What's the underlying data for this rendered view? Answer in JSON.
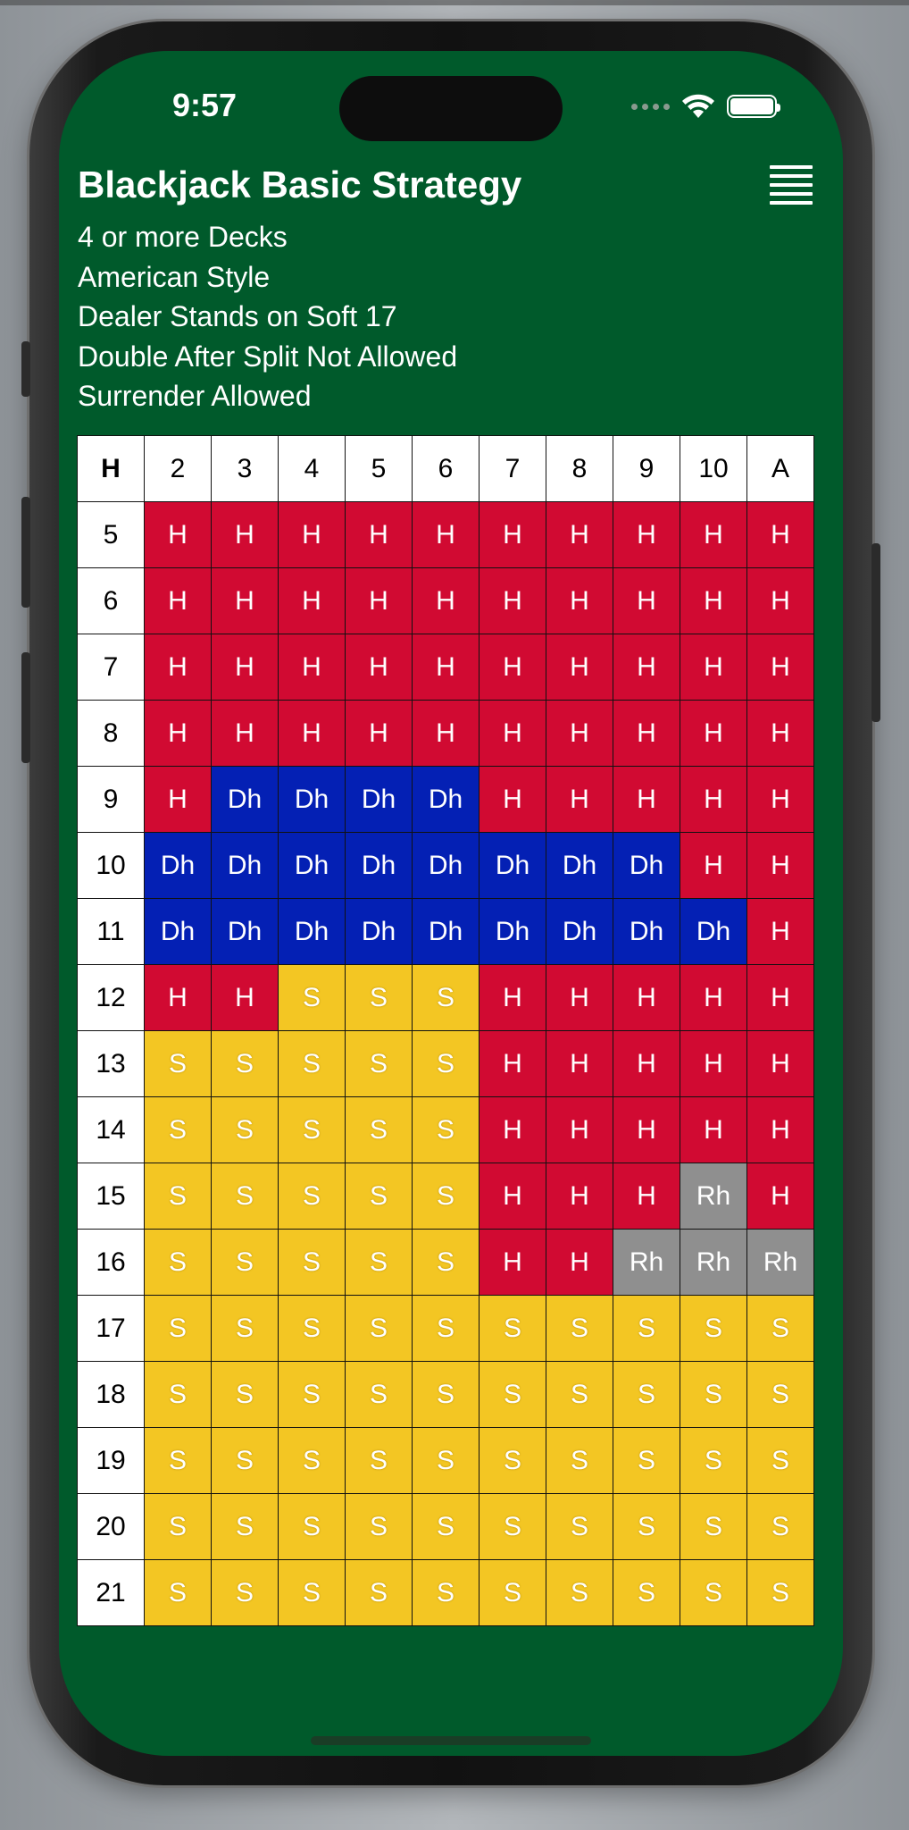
{
  "status_bar": {
    "time": "9:57"
  },
  "header": {
    "title": "Blackjack Basic Strategy",
    "rules": [
      "4 or more Decks",
      "American Style",
      "Dealer Stands on Soft 17",
      "Double After Split Not Allowed",
      "Surrender Allowed"
    ],
    "menu_icon": "hamburger-menu-icon"
  },
  "colors": {
    "background": "#005a2b",
    "H": "#d10a32",
    "Dh": "#0420b4",
    "S": "#f3c623",
    "Rh": "#8f8f8f"
  },
  "table": {
    "corner_label": "H",
    "dealer_cards": [
      "2",
      "3",
      "4",
      "5",
      "6",
      "7",
      "8",
      "9",
      "10",
      "A"
    ],
    "rows": [
      {
        "hand": "5",
        "actions": [
          "H",
          "H",
          "H",
          "H",
          "H",
          "H",
          "H",
          "H",
          "H",
          "H"
        ]
      },
      {
        "hand": "6",
        "actions": [
          "H",
          "H",
          "H",
          "H",
          "H",
          "H",
          "H",
          "H",
          "H",
          "H"
        ]
      },
      {
        "hand": "7",
        "actions": [
          "H",
          "H",
          "H",
          "H",
          "H",
          "H",
          "H",
          "H",
          "H",
          "H"
        ]
      },
      {
        "hand": "8",
        "actions": [
          "H",
          "H",
          "H",
          "H",
          "H",
          "H",
          "H",
          "H",
          "H",
          "H"
        ]
      },
      {
        "hand": "9",
        "actions": [
          "H",
          "Dh",
          "Dh",
          "Dh",
          "Dh",
          "H",
          "H",
          "H",
          "H",
          "H"
        ]
      },
      {
        "hand": "10",
        "actions": [
          "Dh",
          "Dh",
          "Dh",
          "Dh",
          "Dh",
          "Dh",
          "Dh",
          "Dh",
          "H",
          "H"
        ]
      },
      {
        "hand": "11",
        "actions": [
          "Dh",
          "Dh",
          "Dh",
          "Dh",
          "Dh",
          "Dh",
          "Dh",
          "Dh",
          "Dh",
          "H"
        ]
      },
      {
        "hand": "12",
        "actions": [
          "H",
          "H",
          "S",
          "S",
          "S",
          "H",
          "H",
          "H",
          "H",
          "H"
        ]
      },
      {
        "hand": "13",
        "actions": [
          "S",
          "S",
          "S",
          "S",
          "S",
          "H",
          "H",
          "H",
          "H",
          "H"
        ]
      },
      {
        "hand": "14",
        "actions": [
          "S",
          "S",
          "S",
          "S",
          "S",
          "H",
          "H",
          "H",
          "H",
          "H"
        ]
      },
      {
        "hand": "15",
        "actions": [
          "S",
          "S",
          "S",
          "S",
          "S",
          "H",
          "H",
          "H",
          "Rh",
          "H"
        ]
      },
      {
        "hand": "16",
        "actions": [
          "S",
          "S",
          "S",
          "S",
          "S",
          "H",
          "H",
          "Rh",
          "Rh",
          "Rh"
        ]
      },
      {
        "hand": "17",
        "actions": [
          "S",
          "S",
          "S",
          "S",
          "S",
          "S",
          "S",
          "S",
          "S",
          "S"
        ]
      },
      {
        "hand": "18",
        "actions": [
          "S",
          "S",
          "S",
          "S",
          "S",
          "S",
          "S",
          "S",
          "S",
          "S"
        ]
      },
      {
        "hand": "19",
        "actions": [
          "S",
          "S",
          "S",
          "S",
          "S",
          "S",
          "S",
          "S",
          "S",
          "S"
        ]
      },
      {
        "hand": "20",
        "actions": [
          "S",
          "S",
          "S",
          "S",
          "S",
          "S",
          "S",
          "S",
          "S",
          "S"
        ]
      },
      {
        "hand": "21",
        "actions": [
          "S",
          "S",
          "S",
          "S",
          "S",
          "S",
          "S",
          "S",
          "S",
          "S"
        ]
      }
    ]
  }
}
